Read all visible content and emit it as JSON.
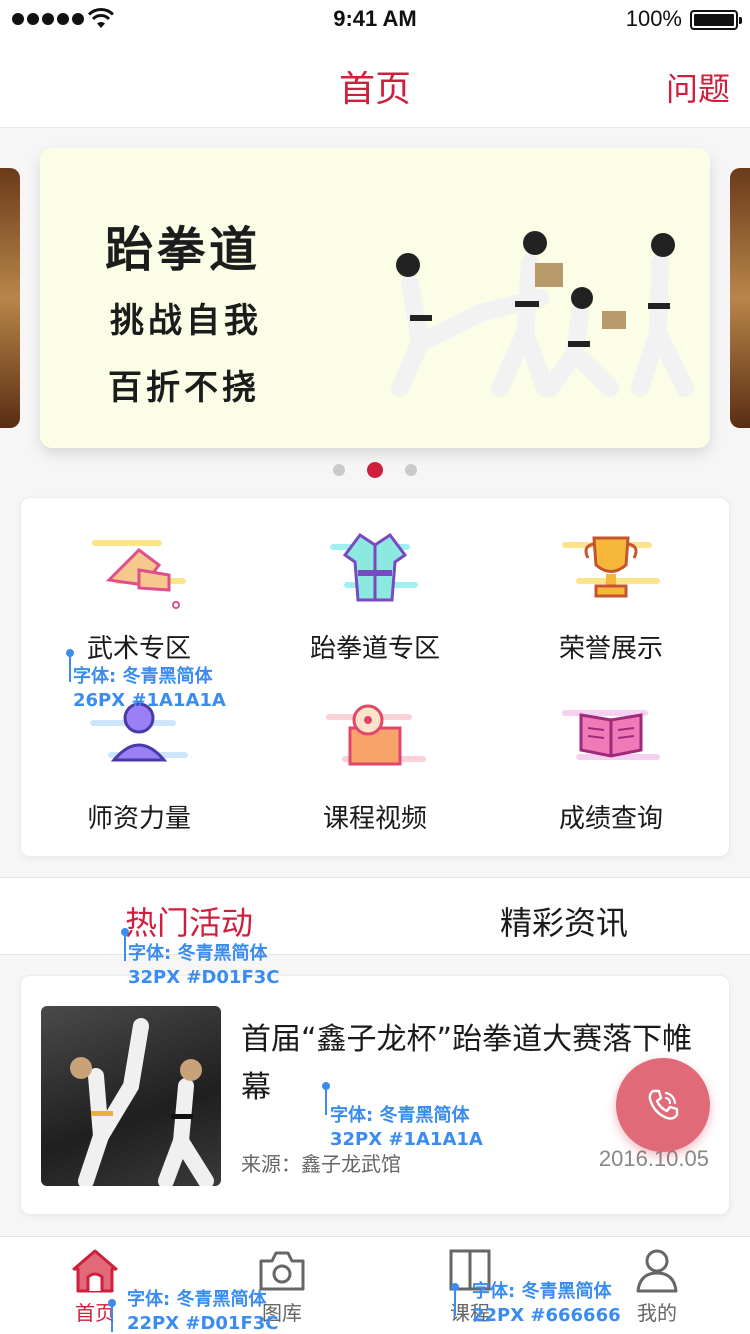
{
  "status_bar": {
    "time": "9:41 AM",
    "battery": "100%"
  },
  "header": {
    "title": "首页",
    "right_action": "问题"
  },
  "banner": {
    "line1": "跆拳道",
    "line2": "挑战自我",
    "line3": "百折不挠",
    "total_slides": 3,
    "active_slide": 2
  },
  "categories": [
    {
      "label": "武术专区",
      "icon": "martial-arts-icon"
    },
    {
      "label": "跆拳道专区",
      "icon": "taekwondo-uniform-icon"
    },
    {
      "label": "荣誉展示",
      "icon": "trophy-icon"
    },
    {
      "label": "师资力量",
      "icon": "teacher-icon"
    },
    {
      "label": "课程视频",
      "icon": "film-reel-icon"
    },
    {
      "label": "成绩查询",
      "icon": "open-book-icon"
    }
  ],
  "tabs": {
    "active": "热门活动",
    "other": "精彩资讯"
  },
  "article": {
    "title": "首届“鑫子龙杯”跆拳道大赛落下帷幕",
    "source": "来源：鑫子龙武馆",
    "date": "2016.10.05"
  },
  "fab": {
    "icon": "phone-icon"
  },
  "tabbar": [
    {
      "label": "首页",
      "icon": "home-icon"
    },
    {
      "label": "图库",
      "icon": "camera-icon"
    },
    {
      "label": "课程",
      "icon": "book-icon"
    },
    {
      "label": "我的",
      "icon": "user-icon"
    }
  ],
  "annotations": {
    "grid_label": {
      "line1": "字体: 冬青黑简体",
      "line2": "26PX #1A1A1A"
    },
    "tab_label": {
      "line1": "字体: 冬青黑简体",
      "line2": "32PX #D01F3C"
    },
    "article_title": {
      "line1": "字体: 冬青黑简体",
      "line2": "32PX #1A1A1A"
    },
    "tabbar_active": {
      "line1": "字体: 冬青黑简体",
      "line2": "22PX #D01F3C"
    },
    "tabbar_inactive": {
      "line1": "字体: 冬青黑简体",
      "line2": "22PX #666666"
    }
  },
  "colors": {
    "accent": "#d01f3c",
    "text": "#1a1a1a",
    "muted": "#666666",
    "annotation": "#3a8cf0"
  }
}
